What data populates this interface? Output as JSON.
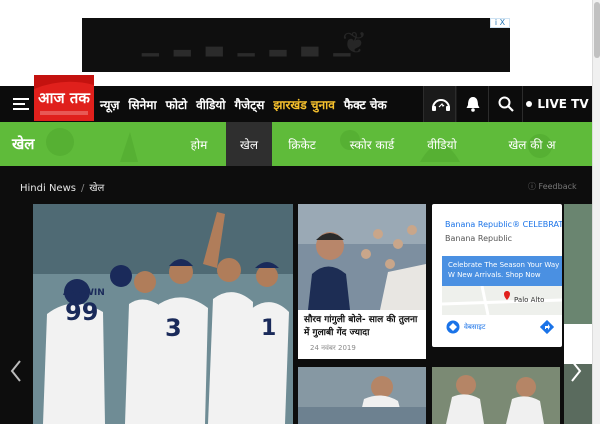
{
  "header": {
    "logo_text": "आज तक",
    "nav": [
      {
        "label": "न्यूज़",
        "highlight": false
      },
      {
        "label": "सिनेमा",
        "highlight": false
      },
      {
        "label": "फोटो",
        "highlight": false
      },
      {
        "label": "वीडियो",
        "highlight": false
      },
      {
        "label": "गैजेट्स",
        "highlight": false
      },
      {
        "label": "झारखंड चुनाव",
        "highlight": true
      },
      {
        "label": "फैक्ट चेक",
        "highlight": false
      }
    ],
    "live_label": "LIVE TV"
  },
  "section": {
    "title": "खेल",
    "subnav": [
      {
        "label": "होम",
        "active": false
      },
      {
        "label": "खेल",
        "active": true
      },
      {
        "label": "क्रिकेट",
        "active": false
      },
      {
        "label": "स्कोर कार्ड",
        "active": false
      },
      {
        "label": "वीडियो",
        "active": false
      },
      {
        "label": "खेल की अ",
        "active": false
      }
    ]
  },
  "breadcrumb": {
    "home": "Hindi News",
    "separator": "/",
    "current": "खेल"
  },
  "feedback_label": "Feedback",
  "stories": {
    "card1_title": "सौरव गांगुली बोले- साल की तुलना में गुलाबी गेंद ज्यादा",
    "card1_date": "24 नवंबर 2019"
  },
  "ad": {
    "title": "Banana Republic® CELEBRATE",
    "advertiser": "Banana Republic",
    "promo": "Celebrate The Season Your Way W New Arrivals. Shop Now",
    "map_label": "Palo Alto",
    "directions_label": "वेबसाइट",
    "ad_choices": "i X"
  },
  "hero_jersey": {
    "ashwin": "ASHWIN",
    "ashwin_num": "99",
    "rahane_num": "3",
    "other_num": "1"
  },
  "colors": {
    "brand_red": "#e0201c",
    "section_green": "#5fbb3a",
    "highlight_yellow": "#f7c12d"
  }
}
